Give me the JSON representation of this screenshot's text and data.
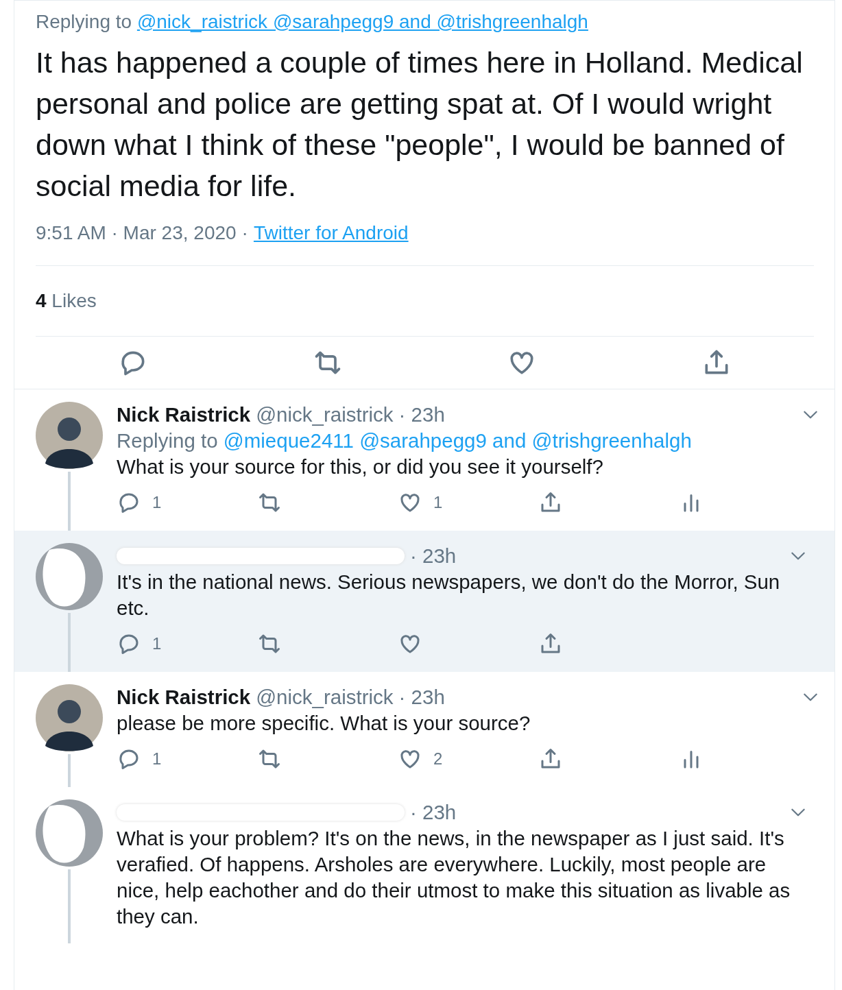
{
  "main_tweet": {
    "replying_label": "Replying to",
    "replying_to": "@nick_raistrick @sarahpegg9 and @trishgreenhalgh",
    "text": "It has happened a couple of times here in Holland. Medical personal and police are getting spat at. Of I would wright down what I think of these \"people\", I would be banned of social media for life.",
    "timestamp": "9:51 AM · Mar 23, 2020",
    "separator": "·",
    "source": "Twitter for Android",
    "likes_count": "4",
    "likes_label": "Likes"
  },
  "replies": [
    {
      "redacted": false,
      "name": "Nick Raistrick",
      "handle": "@nick_raistrick",
      "time": "· 23h",
      "replying_label": "Replying to",
      "replying_to": "@mieque2411 @sarahpegg9 and @trishgreenhalgh",
      "text": "What is your source for this, or did you see it yourself?",
      "highlighted": false,
      "show_actions": true,
      "reply_count": "1",
      "like_count": "1",
      "analytics": true
    },
    {
      "redacted": true,
      "time": "· 23h",
      "text": "It's in the national news. Serious newspapers, we don't do the Morror, Sun etc.",
      "highlighted": true,
      "show_actions": true,
      "reply_count": "1",
      "analytics": false
    },
    {
      "redacted": false,
      "name": "Nick Raistrick",
      "handle": "@nick_raistrick",
      "time": "· 23h",
      "text": "please be more specific. What is your source?",
      "highlighted": false,
      "show_actions": true,
      "reply_count": "1",
      "like_count": "2",
      "analytics": true
    },
    {
      "redacted": true,
      "time": "· 23h",
      "text": "What is your problem? It's on the news, in the newspaper as I just said. It's verafied. Of happens. Arsholes are everywhere. Luckily, most people are nice, help eachother  and do their utmost to make this situation as livable as they can.",
      "highlighted": false,
      "show_actions": false
    }
  ]
}
